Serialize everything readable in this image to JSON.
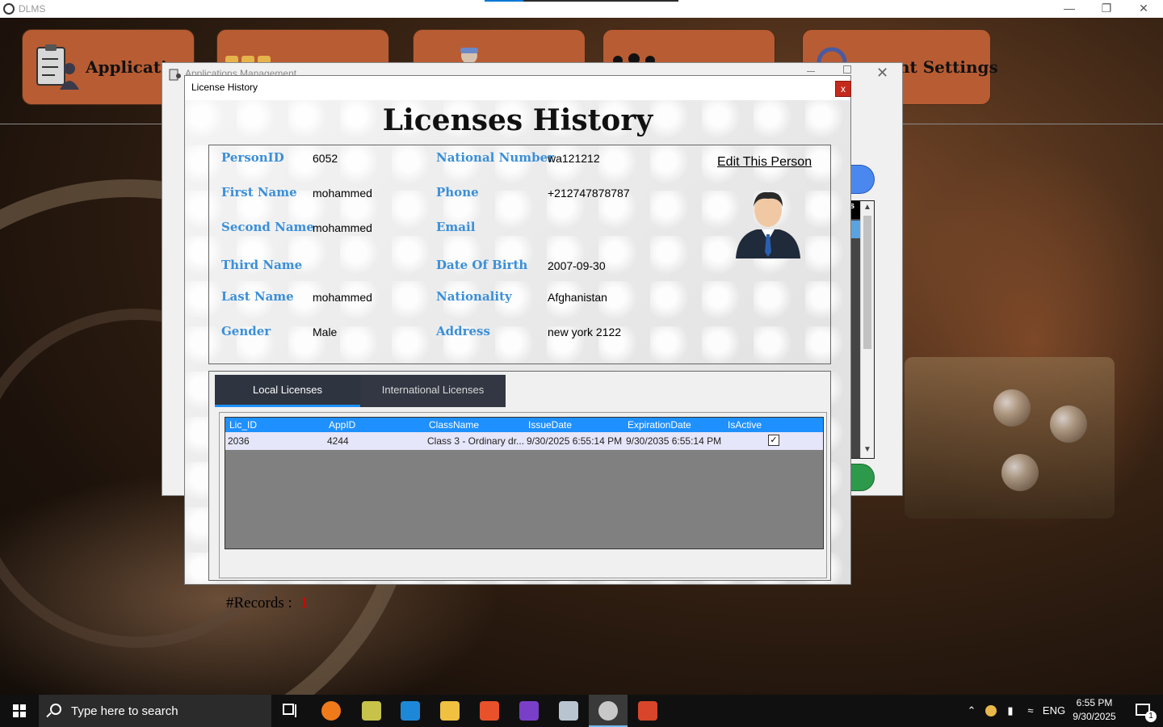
{
  "app": {
    "title": "DLMS"
  },
  "menu": {
    "tiles": [
      {
        "label": "Applicatio"
      },
      {
        "label": ""
      },
      {
        "label": ""
      },
      {
        "label": ""
      },
      {
        "label": "nt Settings"
      }
    ]
  },
  "apps_window": {
    "title": "Applications Management",
    "col_hint": "s"
  },
  "dialog": {
    "title": "License History",
    "close_label": "x",
    "heading": "Licenses History"
  },
  "person": {
    "edit_link": "Edit This Person",
    "labels": {
      "person_id": "PersonID",
      "first_name": "First Name",
      "second_name": "Second Name",
      "third_name": "Third Name",
      "last_name": "Last Name",
      "gender": "Gender",
      "national_number": "National Number",
      "phone": "Phone",
      "email": "Email",
      "date_of_birth": "Date Of Birth",
      "nationality": "Nationality",
      "address": "Address"
    },
    "values": {
      "person_id": "6052",
      "first_name": "mohammed",
      "second_name": "mohammed",
      "third_name": "",
      "last_name": "mohammed",
      "gender": "Male",
      "national_number": "wa121212",
      "phone": "+212747878787",
      "email": "",
      "date_of_birth": "2007-09-30",
      "nationality": "Afghanistan",
      "address": "new york 2122"
    }
  },
  "licenses": {
    "tabs": [
      {
        "label": "Local Licenses",
        "active": true
      },
      {
        "label": "International Licenses",
        "active": false
      }
    ],
    "columns": [
      "Lic_ID",
      "AppID",
      "ClassName",
      "IssueDate",
      "ExpirationDate",
      "IsActive"
    ],
    "rows": [
      {
        "lic_id": "2036",
        "app_id": "4244",
        "class_name": "Class 3 - Ordinary dr...",
        "issue_date": "9/30/2025 6:55:14 PM",
        "expiration_date": "9/30/2035 6:55:14 PM",
        "is_active": true
      }
    ],
    "records_label": "#Records :",
    "records_count": "1"
  },
  "taskbar": {
    "search_placeholder": "Type here to search",
    "language": "ENG",
    "time": "6:55 PM",
    "date": "9/30/2025",
    "notification_count": "1"
  },
  "colors": {
    "accent_label": "#3a8fd8",
    "grid_header": "#1e90ff",
    "records_count": "#e00000",
    "menu_tile": "#b85c33",
    "close_button": "#c42b1c"
  }
}
